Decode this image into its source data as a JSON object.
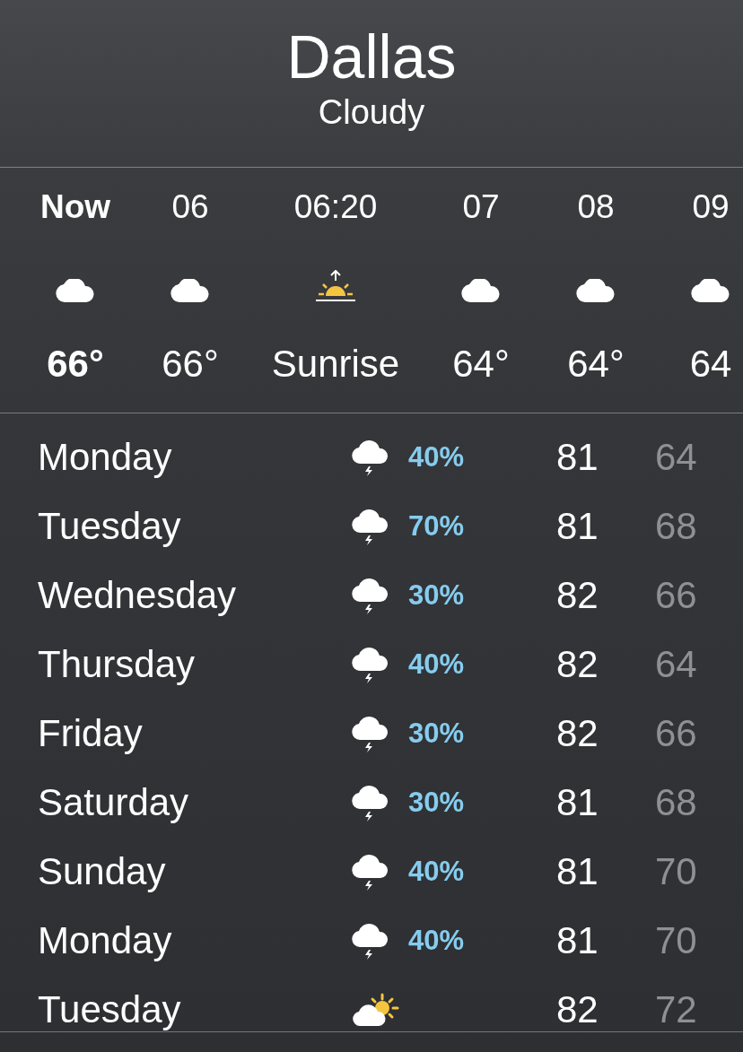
{
  "location": {
    "city": "Dallas",
    "condition": "Cloudy"
  },
  "hourly": [
    {
      "time": "Now",
      "current": true,
      "kind": "cloud",
      "value": "66°"
    },
    {
      "time": "06",
      "current": false,
      "kind": "cloud",
      "value": "66°"
    },
    {
      "time": "06:20",
      "current": false,
      "kind": "sunrise",
      "value": "Sunrise"
    },
    {
      "time": "07",
      "current": false,
      "kind": "cloud",
      "value": "64°"
    },
    {
      "time": "08",
      "current": false,
      "kind": "cloud",
      "value": "64°"
    },
    {
      "time": "09",
      "current": false,
      "kind": "cloud",
      "value": "64"
    }
  ],
  "daily": [
    {
      "day": "Monday",
      "kind": "storm",
      "precip": "40%",
      "high": "81",
      "low": "64"
    },
    {
      "day": "Tuesday",
      "kind": "storm",
      "precip": "70%",
      "high": "81",
      "low": "68"
    },
    {
      "day": "Wednesday",
      "kind": "storm",
      "precip": "30%",
      "high": "82",
      "low": "66"
    },
    {
      "day": "Thursday",
      "kind": "storm",
      "precip": "40%",
      "high": "82",
      "low": "64"
    },
    {
      "day": "Friday",
      "kind": "storm",
      "precip": "30%",
      "high": "82",
      "low": "66"
    },
    {
      "day": "Saturday",
      "kind": "storm",
      "precip": "30%",
      "high": "81",
      "low": "68"
    },
    {
      "day": "Sunday",
      "kind": "storm",
      "precip": "40%",
      "high": "81",
      "low": "70"
    },
    {
      "day": "Monday",
      "kind": "storm",
      "precip": "40%",
      "high": "81",
      "low": "70"
    },
    {
      "day": "Tuesday",
      "kind": "partly-sunny",
      "high": "82",
      "low": "72"
    }
  ]
}
